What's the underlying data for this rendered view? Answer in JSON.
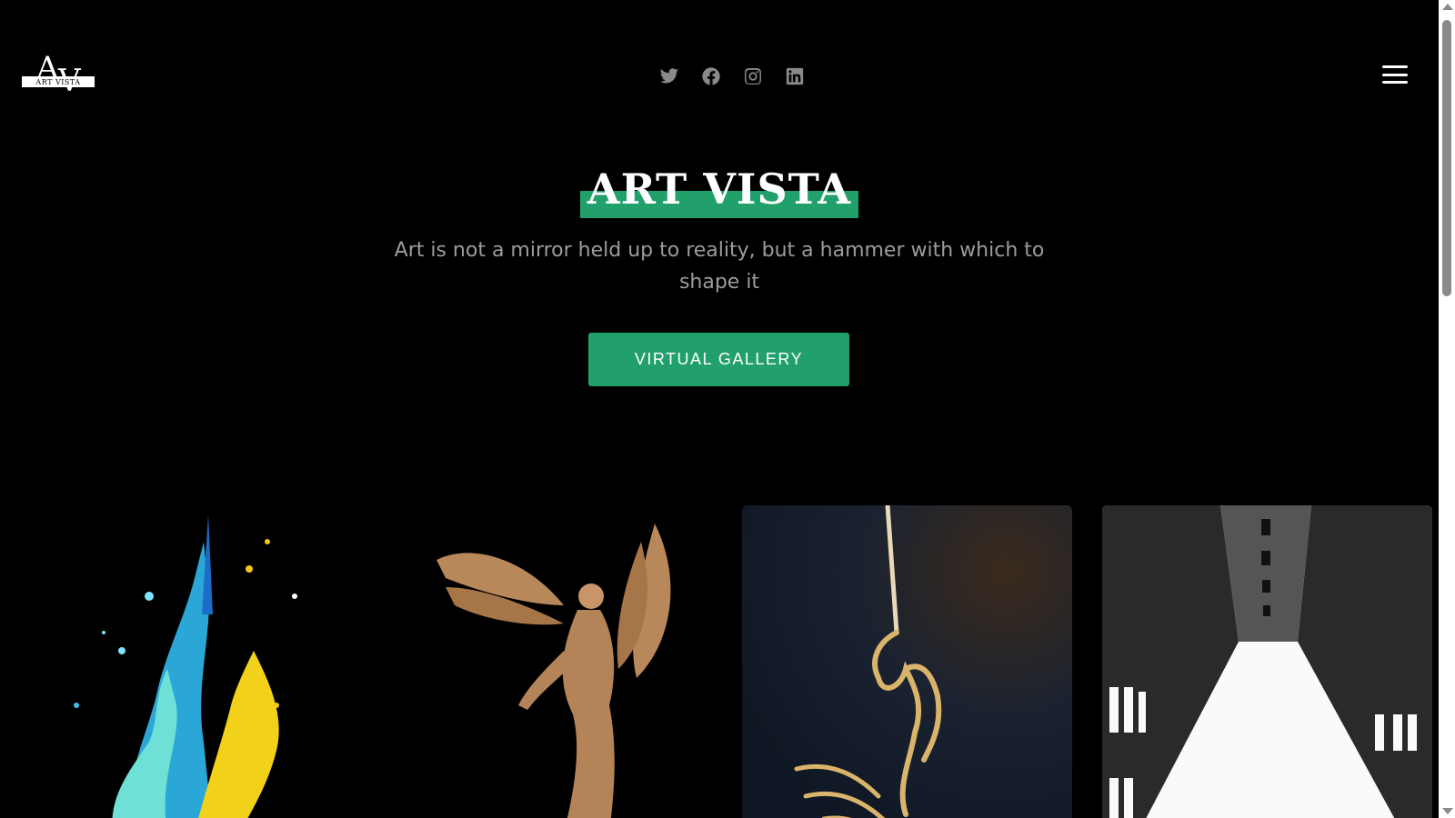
{
  "brand": {
    "logo_text": "ART VISTA",
    "logo_initials": "AV"
  },
  "header": {
    "social": [
      {
        "name": "twitter-icon"
      },
      {
        "name": "facebook-icon"
      },
      {
        "name": "instagram-icon"
      },
      {
        "name": "linkedin-icon"
      }
    ],
    "menu_icon": "hamburger-icon"
  },
  "hero": {
    "title": "ART VISTA",
    "tagline": "Art is not a mirror held up to reality, but a hammer with which to shape it",
    "cta_label": "VIRTUAL GALLERY"
  },
  "gallery": {
    "cards": [
      {
        "subject": "paint-splash"
      },
      {
        "subject": "angel-sculpture"
      },
      {
        "subject": "golden-hand-painting"
      },
      {
        "subject": "building-from-below"
      }
    ]
  },
  "colors": {
    "accent": "#22a06b",
    "background": "#000000",
    "muted_text": "#9c9c9c",
    "icon_gray": "#8a8a8a"
  }
}
